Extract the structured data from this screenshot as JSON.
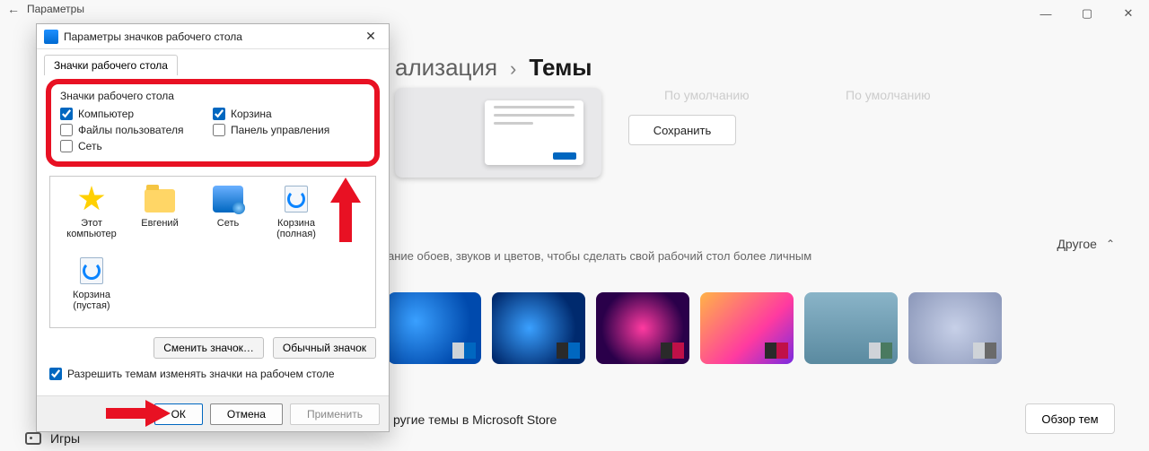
{
  "bg": {
    "back": "←",
    "title": "Параметры",
    "win": {
      "min": "—",
      "max": "▢",
      "close": "✕"
    },
    "crumb1": "ализация",
    "crumbSep": "›",
    "crumb2": "Темы",
    "ghost1": "По умолчанию",
    "ghost2": "По умолчанию",
    "save": "Сохранить",
    "desc": "ание обоев, звуков и цветов, чтобы сделать свой рабочий стол более личным",
    "other": "Другое",
    "otherChev": "⌃",
    "store": "ругие темы в Microsoft Store",
    "browse": "Обзор тем",
    "games": "Игры"
  },
  "dlg": {
    "title": "Параметры значков рабочего стола",
    "close": "✕",
    "tab": "Значки рабочего стола",
    "legend": "Значки рабочего стола",
    "cb": {
      "computer": "Компьютер",
      "recycle": "Корзина",
      "userfiles": "Файлы пользователя",
      "cpanel": "Панель управления",
      "network": "Сеть"
    },
    "icons": {
      "thispc": "Этот компьютер",
      "user": "Евгений",
      "net": "Сеть",
      "binfull": "Корзина (полная)",
      "binempty": "Корзина (пустая)"
    },
    "changeIcon": "Сменить значок…",
    "defaultIcon": "Обычный значок",
    "allow": "Разрешить темам изменять значки на рабочем столе",
    "ok": "ОК",
    "cancel": "Отмена",
    "apply": "Применить"
  }
}
